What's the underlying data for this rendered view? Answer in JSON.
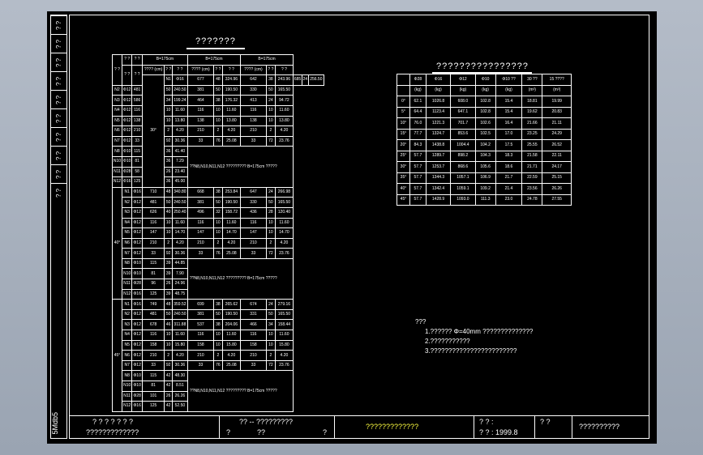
{
  "left_strip": {
    "labels": [
      "? ?",
      "? ?",
      "? ?",
      "? ?",
      "? ?",
      "? ?",
      "? ?",
      "? ?",
      "? ?",
      "? ?"
    ],
    "drawing_code": "5Mdb5"
  },
  "table1": {
    "title": "???????",
    "corner": "? ?",
    "head_row1": [
      "? ?",
      "? ?"
    ],
    "head_row1b": [
      "? ?",
      "? ?"
    ],
    "groups": [
      "B=175cm",
      "B=175cm",
      "B=175cm"
    ],
    "subheads": [
      "???? (cm)",
      "? ?",
      "??? (cm)",
      "? ?",
      "???? (cm)",
      "? ?"
    ],
    "sections": [
      {
        "angle": "30°",
        "rows": [
          [
            "N1",
            "Φ16",
            "677",
            "48",
            "324.96",
            "642",
            "38",
            "243.96",
            "685",
            "24",
            "256.50"
          ],
          [
            "N2",
            "Φ12",
            "481",
            "50",
            "240.50",
            "381",
            "50",
            "190.50",
            "330",
            "50",
            "165.50"
          ],
          [
            "N3",
            "Φ12",
            "586",
            "34",
            "199.24",
            "464",
            "38",
            "176.32",
            "413",
            "24",
            "94.72"
          ],
          [
            "N4",
            "Φ12",
            "116",
            "10",
            "11.60",
            "116",
            "10",
            "11.60",
            "116",
            "10",
            "11.60"
          ],
          [
            "N5",
            "Φ12",
            "138",
            "10",
            "13.80",
            "138",
            "10",
            "13.80",
            "138",
            "10",
            "13.80"
          ],
          [
            "N6",
            "Φ12",
            "210",
            "2",
            "4.20",
            "210",
            "2",
            "4.20",
            "210",
            "2",
            "4.20"
          ],
          [
            "N7",
            "Φ12",
            "33",
            "92",
            "30.36",
            "33",
            "76",
            "25.08",
            "33",
            "72",
            "23.76"
          ],
          [
            "N8",
            "Φ10",
            "115",
            "36",
            "41.40"
          ],
          [
            "N10",
            "Φ10",
            "81",
            "36",
            "7.29"
          ],
          [
            "N11",
            "Φ28",
            "58",
            "26",
            "23.40"
          ],
          [
            "N12",
            "Φ16",
            "125",
            "36",
            "45.00"
          ]
        ],
        "merged_note": "??N8,N10,N11,N12 ????????? B=175cm ?????"
      },
      {
        "angle": "40°",
        "rows": [
          [
            "N1",
            "Φ16",
            "710",
            "48",
            "340.80",
            "668",
            "38",
            "253.84",
            "647",
            "24",
            "266.98"
          ],
          [
            "N2",
            "Φ12",
            "481",
            "50",
            "240.50",
            "381",
            "50",
            "190.50",
            "330",
            "50",
            "165.50"
          ],
          [
            "N3",
            "Φ12",
            "626",
            "40",
            "250.40",
            "496",
            "32",
            "158.72",
            "436",
            "28",
            "120.40"
          ],
          [
            "N4",
            "Φ12",
            "116",
            "10",
            "11.60",
            "116",
            "10",
            "11.60",
            "116",
            "10",
            "11.60"
          ],
          [
            "N5",
            "Φ12",
            "147",
            "10",
            "14.70",
            "147",
            "10",
            "14.70",
            "147",
            "10",
            "14.70"
          ],
          [
            "N6",
            "Φ12",
            "210",
            "2",
            "4.20",
            "210",
            "2",
            "4.20",
            "210",
            "2",
            "4.20"
          ],
          [
            "N7",
            "Φ12",
            "33",
            "92",
            "30.36",
            "33",
            "76",
            "25.08",
            "33",
            "72",
            "23.76"
          ],
          [
            "N8",
            "Φ10",
            "115",
            "39",
            "44.85"
          ],
          [
            "N10",
            "Φ10",
            "81",
            "39",
            "7.90"
          ],
          [
            "N11",
            "Φ28",
            "96",
            "26",
            "24.96"
          ],
          [
            "N12",
            "Φ16",
            "125",
            "39",
            "48.75"
          ]
        ],
        "merged_note": "??N8,N10,N11,N12 ????????? B=175cm ?????"
      },
      {
        "angle": "45°",
        "rows": [
          [
            "N1",
            "Φ16",
            "749",
            "48",
            "359.52",
            "699",
            "38",
            "265.62",
            "674",
            "24",
            "279.16"
          ],
          [
            "N2",
            "Φ12",
            "481",
            "50",
            "240.50",
            "381",
            "50",
            "190.50",
            "331",
            "50",
            "165.50"
          ],
          [
            "N3",
            "Φ12",
            "678",
            "46",
            "311.88",
            "537",
            "38",
            "204.06",
            "466",
            "34",
            "158.44"
          ],
          [
            "N4",
            "Φ12",
            "116",
            "10",
            "11.60",
            "116",
            "10",
            "11.60",
            "116",
            "10",
            "11.60"
          ],
          [
            "N5",
            "Φ12",
            "158",
            "10",
            "15.80",
            "158",
            "10",
            "15.80",
            "158",
            "10",
            "15.80"
          ],
          [
            "N6",
            "Φ12",
            "210",
            "2",
            "4.20",
            "210",
            "2",
            "4.20",
            "210",
            "2",
            "4.20"
          ],
          [
            "N7",
            "Φ12",
            "33",
            "92",
            "30.36",
            "33",
            "76",
            "25.08",
            "33",
            "72",
            "23.76"
          ],
          [
            "N8",
            "Φ10",
            "115",
            "42",
            "48.30"
          ],
          [
            "N10",
            "Φ10",
            "81",
            "42",
            "8.51"
          ],
          [
            "N11",
            "Φ28",
            "101",
            "26",
            "26.26"
          ],
          [
            "N12",
            "Φ16",
            "125",
            "42",
            "52.50"
          ]
        ],
        "merged_note": "??N8,N10,N11,N12 ????????? B=175cm ?????"
      }
    ]
  },
  "table2": {
    "title": "????????????????",
    "head1": [
      "",
      "Φ28",
      "Φ16",
      "Φ12",
      "Φ10",
      "Φ10 ??",
      "30 ??",
      "15 ????"
    ],
    "head2": [
      "",
      "(kg)",
      "(kg)",
      "(kg)",
      "(kg)",
      "(kg)",
      "(m³)",
      "(m³)"
    ],
    "rows": [
      [
        "0°",
        "62.1",
        "1026.8",
        "608.0",
        "102.8",
        "15.4",
        "18.81",
        "19.99"
      ],
      [
        "5°",
        "64.4",
        "1123.4",
        "647.1",
        "102.8",
        "15.4",
        "19.62",
        "20.83"
      ],
      [
        "10°",
        "76.0",
        "1221.3",
        "701.7",
        "102.6",
        "16.4",
        "21.66",
        "21.11"
      ],
      [
        "15°",
        "77.7",
        "1324.7",
        "853.6",
        "102.5",
        "17.0",
        "23.25",
        "24.29"
      ],
      [
        "20°",
        "84.3",
        "1438.8",
        "1004.4",
        "104.2",
        "17.5",
        "25.55",
        "26.52"
      ],
      [
        "25°",
        "57.7",
        "1289.7",
        "898.2",
        "104.3",
        "18.3",
        "21.58",
        "22.11"
      ],
      [
        "30°",
        "57.7",
        "1253.7",
        "868.6",
        "105.6",
        "18.6",
        "21.71",
        "24.17"
      ],
      [
        "35°",
        "57.7",
        "1344.3",
        "1057.1",
        "106.9",
        "21.7",
        "22.59",
        "25.15"
      ],
      [
        "40°",
        "57.7",
        "1342.4",
        "1059.1",
        "109.2",
        "21.4",
        "23.56",
        "26.26"
      ],
      [
        "45°",
        "57.7",
        "1428.9",
        "1093.0",
        "111.3",
        "23.0",
        "24.78",
        "27.55"
      ]
    ]
  },
  "notes": {
    "heading": "???",
    "items": [
      "1.??????   Φ=40mm         ??????????????",
      "2.???????????",
      "3.????????????????????????"
    ]
  },
  "title_block": {
    "c1_top": "? ? ? ? ? ? ?",
    "c1_bottom": "?????????????",
    "c2_top": "?? -- ?????????",
    "c2_bottom_a": "?",
    "c2_bottom_b": "??",
    "c2_bottom_c": "?",
    "c3": "?????????????",
    "c4_top": "? ? :",
    "c4_bottom": "? ? :  1999.8",
    "c5": "?   ?",
    "c6": "??????????"
  }
}
